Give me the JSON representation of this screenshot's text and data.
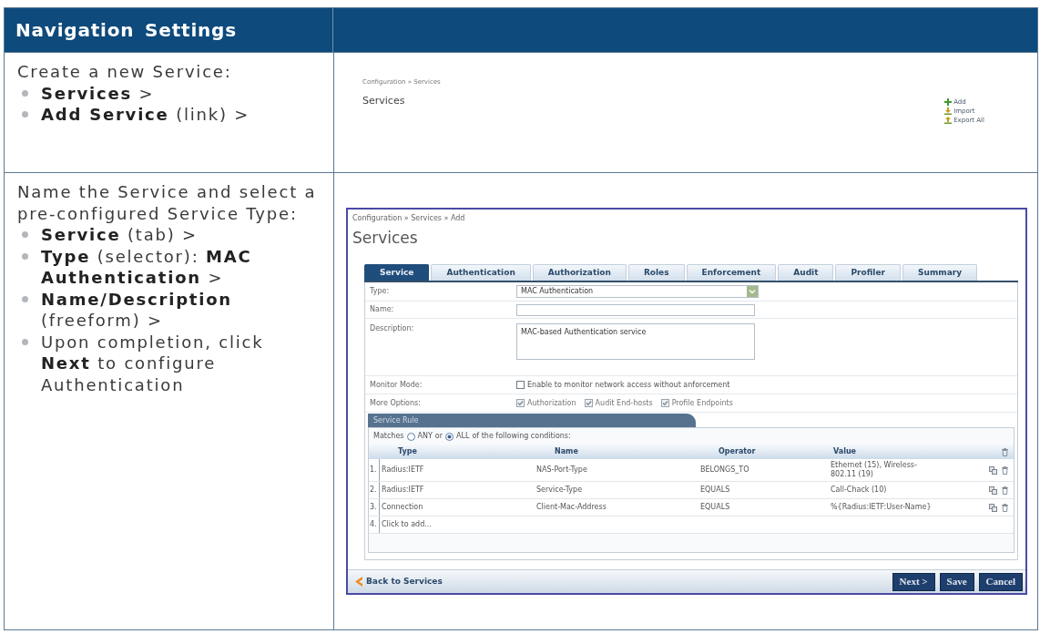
{
  "header": {
    "title": "Navigation Settings"
  },
  "steps": [
    {
      "intro": "Create a new Service:",
      "bullets": [
        "**Services** >",
        "**Add Service** (link) >"
      ],
      "screen": {
        "kind": "list",
        "breadcrumb": "Configuration » Services",
        "title": "Services",
        "actions": [
          {
            "kind": "add",
            "label": "Add"
          },
          {
            "kind": "import",
            "label": "Import"
          },
          {
            "kind": "export",
            "label": "Export All"
          }
        ]
      }
    },
    {
      "intro": "Name the Service and select a pre-configured Service Type:",
      "bullets": [
        "**Service** (tab) >",
        "**Type** (selector): **MAC Authentication** >",
        "**Name/Description** (freeform) >",
        "Upon completion, click **Next** to configure Authentication"
      ],
      "screen": {
        "kind": "form",
        "breadcrumb": "Configuration » Services » Add",
        "title": "Services",
        "tabs": [
          {
            "label": "Service",
            "selected": true
          },
          {
            "label": "Authentication",
            "selected": false
          },
          {
            "label": "Authorization",
            "selected": false
          },
          {
            "label": "Roles",
            "selected": false
          },
          {
            "label": "Enforcement",
            "selected": false
          },
          {
            "label": "Audit",
            "selected": false
          },
          {
            "label": "Profiler",
            "selected": false
          },
          {
            "label": "Summary",
            "selected": false
          }
        ],
        "fields": [
          {
            "kind": "select",
            "label": "Type:",
            "value": "MAC Authentication"
          },
          {
            "kind": "text",
            "label": "Name:"
          },
          {
            "kind": "textarea",
            "label": "Description:",
            "value": "MAC-based Authentication service"
          },
          {
            "kind": "checks",
            "label": "Monitor Mode:",
            "options": [
              {
                "label": "Enable to monitor network access without anforcement",
                "checked": false
              }
            ]
          },
          {
            "kind": "checks",
            "label": "More Options:",
            "options": [
              {
                "label": "Authorization",
                "checked": true
              },
              {
                "label": "Audit End-hosts",
                "checked": true
              },
              {
                "label": "Profile Endpoints",
                "checked": true
              }
            ]
          }
        ],
        "rule": {
          "title": "Service Rule",
          "prefix": "Matches",
          "options": [
            {
              "label": "ANY",
              "selected": false
            },
            {
              "label": "ALL",
              "selected": true
            }
          ],
          "connector": "or",
          "suffix": "of the following conditions:",
          "columns": [
            "Type",
            "Name",
            "Operator",
            "Value"
          ],
          "rows": [
            {
              "number": "1.",
              "type": "Radius:IETF",
              "name": "NAS-Port-Type",
              "operator": "BELONGS_TO",
              "value": "Ethernet (15), Wireless-802.11 (19)"
            },
            {
              "number": "2.",
              "type": "Radius:IETF",
              "name": "Service-Type",
              "operator": "EQUALS",
              "value": "Call-Chack (10)"
            },
            {
              "number": "3.",
              "type": "Connection",
              "name": "Client-Mac-Address",
              "operator": "EQUALS",
              "value": "%{Radius:IETF:User-Name}"
            }
          ],
          "add_row": {
            "number": "4.",
            "label": "Click to add..."
          }
        },
        "back_link": "Back to Services",
        "buttons": [
          "Next >",
          "Save",
          "Cancel"
        ]
      }
    }
  ]
}
